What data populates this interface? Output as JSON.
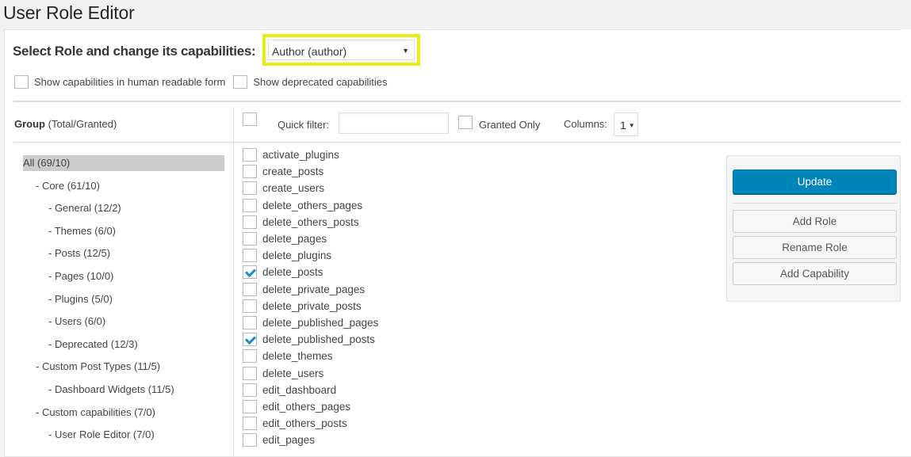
{
  "page": {
    "title": "User Role Editor"
  },
  "role_selector": {
    "label": "Select Role and change its capabilities:",
    "selected": "Author (author)",
    "highlight_color": "#ecec14"
  },
  "options": {
    "human_readable": {
      "label": "Show capabilities in human readable form",
      "checked": false
    },
    "deprecated": {
      "label": "Show deprecated capabilities",
      "checked": false
    }
  },
  "group_header": {
    "bold": "Group",
    "rest": " (Total/Granted)"
  },
  "toolbar": {
    "select_all_checked": false,
    "quick_filter_label": "Quick filter:",
    "quick_filter_value": "",
    "granted_only_label": "Granted Only",
    "granted_only_checked": false,
    "columns_label": "Columns:",
    "columns_value": "1"
  },
  "groups": [
    {
      "label": "All (69/10)",
      "level": 0,
      "selected": true
    },
    {
      "label": "- Core (61/10)",
      "level": 1,
      "selected": false
    },
    {
      "label": "- General (12/2)",
      "level": 2,
      "selected": false
    },
    {
      "label": "- Themes (6/0)",
      "level": 2,
      "selected": false
    },
    {
      "label": "- Posts (12/5)",
      "level": 2,
      "selected": false
    },
    {
      "label": "- Pages (10/0)",
      "level": 2,
      "selected": false
    },
    {
      "label": "- Plugins (5/0)",
      "level": 2,
      "selected": false
    },
    {
      "label": "- Users (6/0)",
      "level": 2,
      "selected": false
    },
    {
      "label": "- Deprecated (12/3)",
      "level": 2,
      "selected": false
    },
    {
      "label": "- Custom Post Types (11/5)",
      "level": 1,
      "selected": false
    },
    {
      "label": "- Dashboard Widgets (11/5)",
      "level": 2,
      "selected": false
    },
    {
      "label": "- Custom capabilities (7/0)",
      "level": 1,
      "selected": false
    },
    {
      "label": "- User Role Editor (7/0)",
      "level": 2,
      "selected": false
    }
  ],
  "capabilities": [
    {
      "name": "activate_plugins",
      "checked": false
    },
    {
      "name": "create_posts",
      "checked": false
    },
    {
      "name": "create_users",
      "checked": false
    },
    {
      "name": "delete_others_pages",
      "checked": false
    },
    {
      "name": "delete_others_posts",
      "checked": false
    },
    {
      "name": "delete_pages",
      "checked": false
    },
    {
      "name": "delete_plugins",
      "checked": false
    },
    {
      "name": "delete_posts",
      "checked": true
    },
    {
      "name": "delete_private_pages",
      "checked": false
    },
    {
      "name": "delete_private_posts",
      "checked": false
    },
    {
      "name": "delete_published_pages",
      "checked": false
    },
    {
      "name": "delete_published_posts",
      "checked": true
    },
    {
      "name": "delete_themes",
      "checked": false
    },
    {
      "name": "delete_users",
      "checked": false
    },
    {
      "name": "edit_dashboard",
      "checked": false
    },
    {
      "name": "edit_others_pages",
      "checked": false
    },
    {
      "name": "edit_others_posts",
      "checked": false
    },
    {
      "name": "edit_pages",
      "checked": false
    }
  ],
  "actions": {
    "update": "Update",
    "add_role": "Add Role",
    "rename_role": "Rename Role",
    "add_capability": "Add Capability",
    "primary_color": "#0085ba"
  }
}
